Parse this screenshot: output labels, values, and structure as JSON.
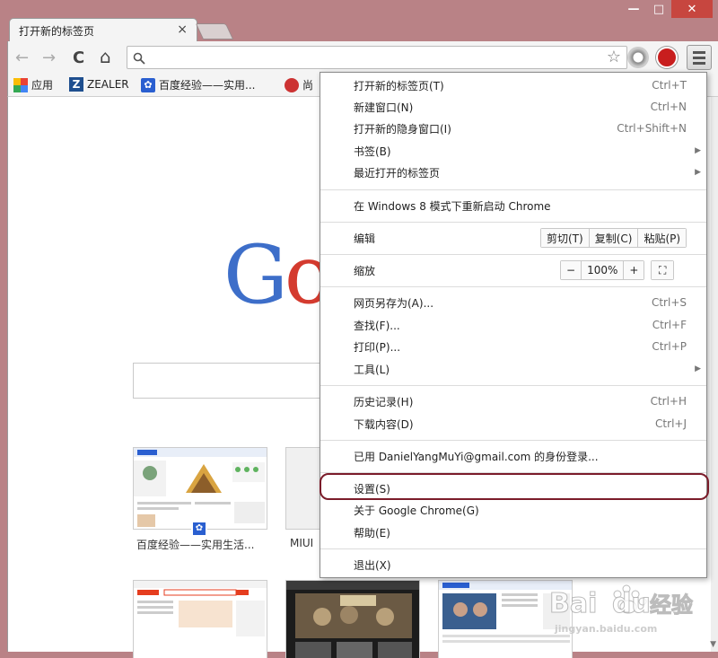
{
  "window": {
    "minimize": "—",
    "maximize": "□",
    "close": "✕"
  },
  "tab": {
    "title": "打开新的标签页",
    "close_glyph": "×"
  },
  "toolbar": {
    "back_glyph": "←",
    "forward_glyph": "→",
    "reload_glyph": "C",
    "home_glyph": "⌂",
    "address_value": "",
    "star_glyph": "☆"
  },
  "bookmarks": [
    {
      "label": "应用",
      "icon": "apps-grid-icon"
    },
    {
      "label": "ZEALER",
      "icon": "zealer-logo-icon"
    },
    {
      "label": "百度经验——实用...",
      "icon": "baidu-paw-icon"
    },
    {
      "label": "尚",
      "icon": "site-favicon"
    }
  ],
  "content": {
    "logo_g": "G",
    "logo_o": "o",
    "thumbnails": [
      {
        "label": "百度经验——实用生活..."
      },
      {
        "label": "MIUI"
      },
      {
        "label": ""
      },
      {
        "label": ""
      },
      {
        "label": ""
      }
    ]
  },
  "menu": {
    "new_tab": {
      "label": "打开新的标签页(T)",
      "shortcut": "Ctrl+T"
    },
    "new_window": {
      "label": "新建窗口(N)",
      "shortcut": "Ctrl+N"
    },
    "incognito": {
      "label": "打开新的隐身窗口(I)",
      "shortcut": "Ctrl+Shift+N"
    },
    "bookmarks": {
      "label": "书签(B)"
    },
    "recent_tabs": {
      "label": "最近打开的标签页"
    },
    "relaunch": {
      "label": "在 Windows 8 模式下重新启动 Chrome"
    },
    "edit": {
      "label": "编辑",
      "cut": "剪切(T)",
      "copy": "复制(C)",
      "paste": "粘贴(P)"
    },
    "zoom": {
      "label": "缩放",
      "minus": "−",
      "level": "100%",
      "plus": "+",
      "fullscreen": "⛶"
    },
    "save_as": {
      "label": "网页另存为(A)...",
      "shortcut": "Ctrl+S"
    },
    "find": {
      "label": "查找(F)...",
      "shortcut": "Ctrl+F"
    },
    "print": {
      "label": "打印(P)...",
      "shortcut": "Ctrl+P"
    },
    "tools": {
      "label": "工具(L)"
    },
    "history": {
      "label": "历史记录(H)",
      "shortcut": "Ctrl+H"
    },
    "downloads": {
      "label": "下载内容(D)",
      "shortcut": "Ctrl+J"
    },
    "signed_in": {
      "label": "已用 DanielYangMuYi@gmail.com 的身份登录..."
    },
    "settings": {
      "label": "设置(S)"
    },
    "about": {
      "label": "关于 Google Chrome(G)"
    },
    "help": {
      "label": "帮助(E)"
    },
    "exit": {
      "label": "退出(X)"
    },
    "arrow_glyph": "▶"
  },
  "colors": {
    "frame": "#b98286",
    "highlight_ring": "#7b1c2a"
  }
}
